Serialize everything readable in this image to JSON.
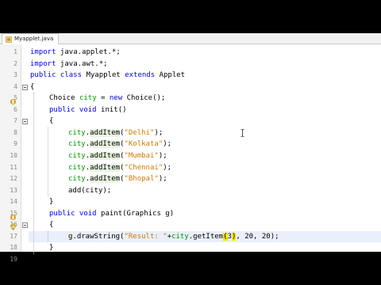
{
  "tab": {
    "title": "Myapplet.java"
  },
  "lines": [
    {
      "n": "1",
      "text": "import java.applet.*;"
    },
    {
      "n": "2",
      "text": "import java.awt.*;"
    },
    {
      "n": "3",
      "text": "public class Myapplet extends Applet"
    },
    {
      "n": "4",
      "text": "{"
    },
    {
      "n": "5",
      "text": "Choice city = new Choice();"
    },
    {
      "n": "6",
      "text": "public void init()"
    },
    {
      "n": "7",
      "text": "{"
    },
    {
      "n": "8",
      "text": "city.addItem(\"Delhi\");"
    },
    {
      "n": "9",
      "text": "city.addItem(\"Kolkata\");"
    },
    {
      "n": "10",
      "text": "city.addItem(\"Mumbai\");"
    },
    {
      "n": "11",
      "text": "city.addItem(\"Chennai\");"
    },
    {
      "n": "12",
      "text": "city.addItem(\"Bhopal\");"
    },
    {
      "n": "13",
      "text": "add(city);"
    },
    {
      "n": "14",
      "text": "}"
    },
    {
      "n": "15",
      "text": "public void paint(Graphics g)"
    },
    {
      "n": "16",
      "text": "{"
    },
    {
      "n": "17",
      "text": "g.drawString(\"Result: \"+city.getItem(3), 20, 20);"
    },
    {
      "n": "18",
      "text": "}"
    },
    {
      "n": "19",
      "text": "}"
    }
  ],
  "tokens": {
    "l1": [
      "import",
      " java.applet.*;"
    ],
    "l2": [
      "import",
      " java.awt.*;"
    ],
    "l3": [
      "public class",
      " Myapplet ",
      "extends",
      " Applet"
    ],
    "l5": [
      "Choice ",
      "city",
      " = ",
      "new",
      " Choice();"
    ],
    "l6": [
      "public void",
      " init()"
    ],
    "l8": [
      "city",
      ".",
      "addItem",
      "(",
      "\"Delhi\"",
      ");"
    ],
    "l9": [
      "city",
      ".",
      "addItem",
      "(",
      "\"Kolkata\"",
      ");"
    ],
    "l10": [
      "city",
      ".",
      "addItem",
      "(",
      "\"Mumbai\"",
      ");"
    ],
    "l11": [
      "city",
      ".",
      "addItem",
      "(",
      "\"Chennai\"",
      ");"
    ],
    "l12": [
      "city",
      ".",
      "addItem",
      "(",
      "\"Bhopal\"",
      ");"
    ],
    "l13": [
      "add(city);"
    ],
    "l15": [
      "public void",
      " paint(Graphics g)"
    ],
    "l17": [
      "g",
      ".drawString(",
      "\"Result: \"",
      "+",
      "city",
      ".getItem",
      "(",
      "3",
      ")",
      ", 20, 20);"
    ]
  },
  "colors": {
    "keyword": "#0000e6",
    "string": "#ce7b00",
    "field": "#009900",
    "bracket_match": "#f3e600",
    "current_line": "#e9effb"
  },
  "icons": {
    "tab_icon": "java-file-icon",
    "gutter_line5": "override-marker-icon",
    "gutter_line15": "override-marker-icon",
    "gutter_line17": "hint-bulb-icon"
  }
}
